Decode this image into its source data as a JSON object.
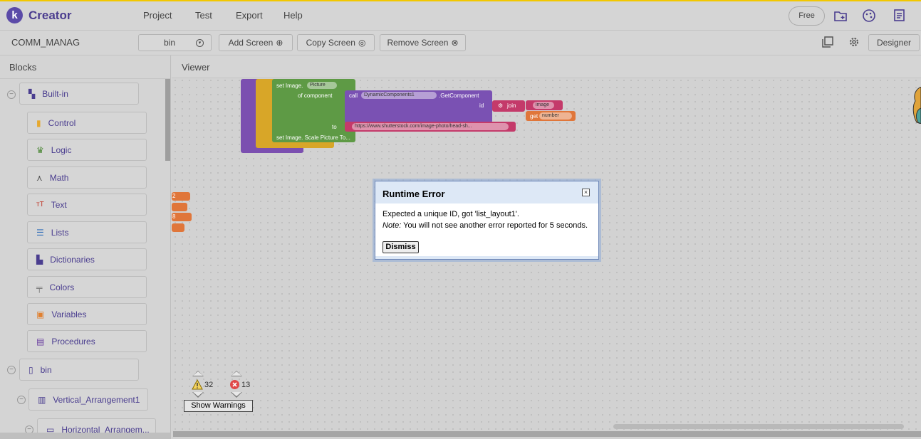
{
  "app": {
    "logo_letter": "k",
    "title": "Creator"
  },
  "menu": {
    "project": "Project",
    "test": "Test",
    "export": "Export",
    "help": "Help"
  },
  "top_actions": {
    "plan": "Free",
    "icons": [
      "new-folder-icon",
      "palette-icon",
      "projects-icon"
    ]
  },
  "toolbar": {
    "project_name": "COMM_MANAG",
    "screen_select": "bin",
    "add_screen": "Add Screen",
    "copy_screen": "Copy Screen",
    "remove_screen": "Remove Screen",
    "designer": "Designer",
    "icons": [
      "gallery-icon",
      "settings-icon"
    ]
  },
  "blocks_panel": {
    "title": "Blocks",
    "builtin": "Built-in",
    "categories": [
      {
        "label": "Control",
        "icon": "control-icon",
        "color": "#e6a82e"
      },
      {
        "label": "Logic",
        "icon": "logic-icon",
        "color": "#4f8a3a"
      },
      {
        "label": "Math",
        "icon": "math-icon",
        "color": "#555555"
      },
      {
        "label": "Text",
        "icon": "text-icon",
        "color": "#c0392b"
      },
      {
        "label": "Lists",
        "icon": "lists-icon",
        "color": "#2e6cb8"
      },
      {
        "label": "Dictionaries",
        "icon": "dictionaries-icon",
        "color": "#4a3d8f"
      },
      {
        "label": "Colors",
        "icon": "colors-icon",
        "color": "#777777"
      },
      {
        "label": "Variables",
        "icon": "variables-icon",
        "color": "#e08030"
      },
      {
        "label": "Procedures",
        "icon": "procedures-icon",
        "color": "#6a3da0"
      }
    ],
    "screen": "bin",
    "vertical_arrangement": "Vertical_Arrangement1",
    "horizontal_arrangement": "Horizontal_Arrangem..."
  },
  "viewer": {
    "title": "Viewer",
    "blocks": {
      "set_image": "set Image.",
      "picture": "Picture",
      "of_component": "of component",
      "call": "call",
      "dynamic_components": "DynamicComponents1",
      "get_component": ".GetComponent",
      "id": "id",
      "join": "join",
      "image_text": "image",
      "get": "get",
      "number": "number",
      "to": "to",
      "url": "https://www.shutterstock.com/image-photo/head-sh...",
      "set_scale": "set Image. Scale Picture To...",
      "side_labels": [
        "2",
        "",
        "8",
        ""
      ]
    }
  },
  "dialog": {
    "title": "Runtime Error",
    "message": "Expected a unique ID, got 'list_layout1'.",
    "note_label": "Note:",
    "note_text": " You will not see another error reported for 5 seconds.",
    "dismiss": "Dismiss"
  },
  "warnings": {
    "warning_count": "32",
    "error_count": "13",
    "show_warnings": "Show Warnings"
  },
  "colors": {
    "brand": "#5b4aa8",
    "accent_bar": "#f2c700"
  }
}
